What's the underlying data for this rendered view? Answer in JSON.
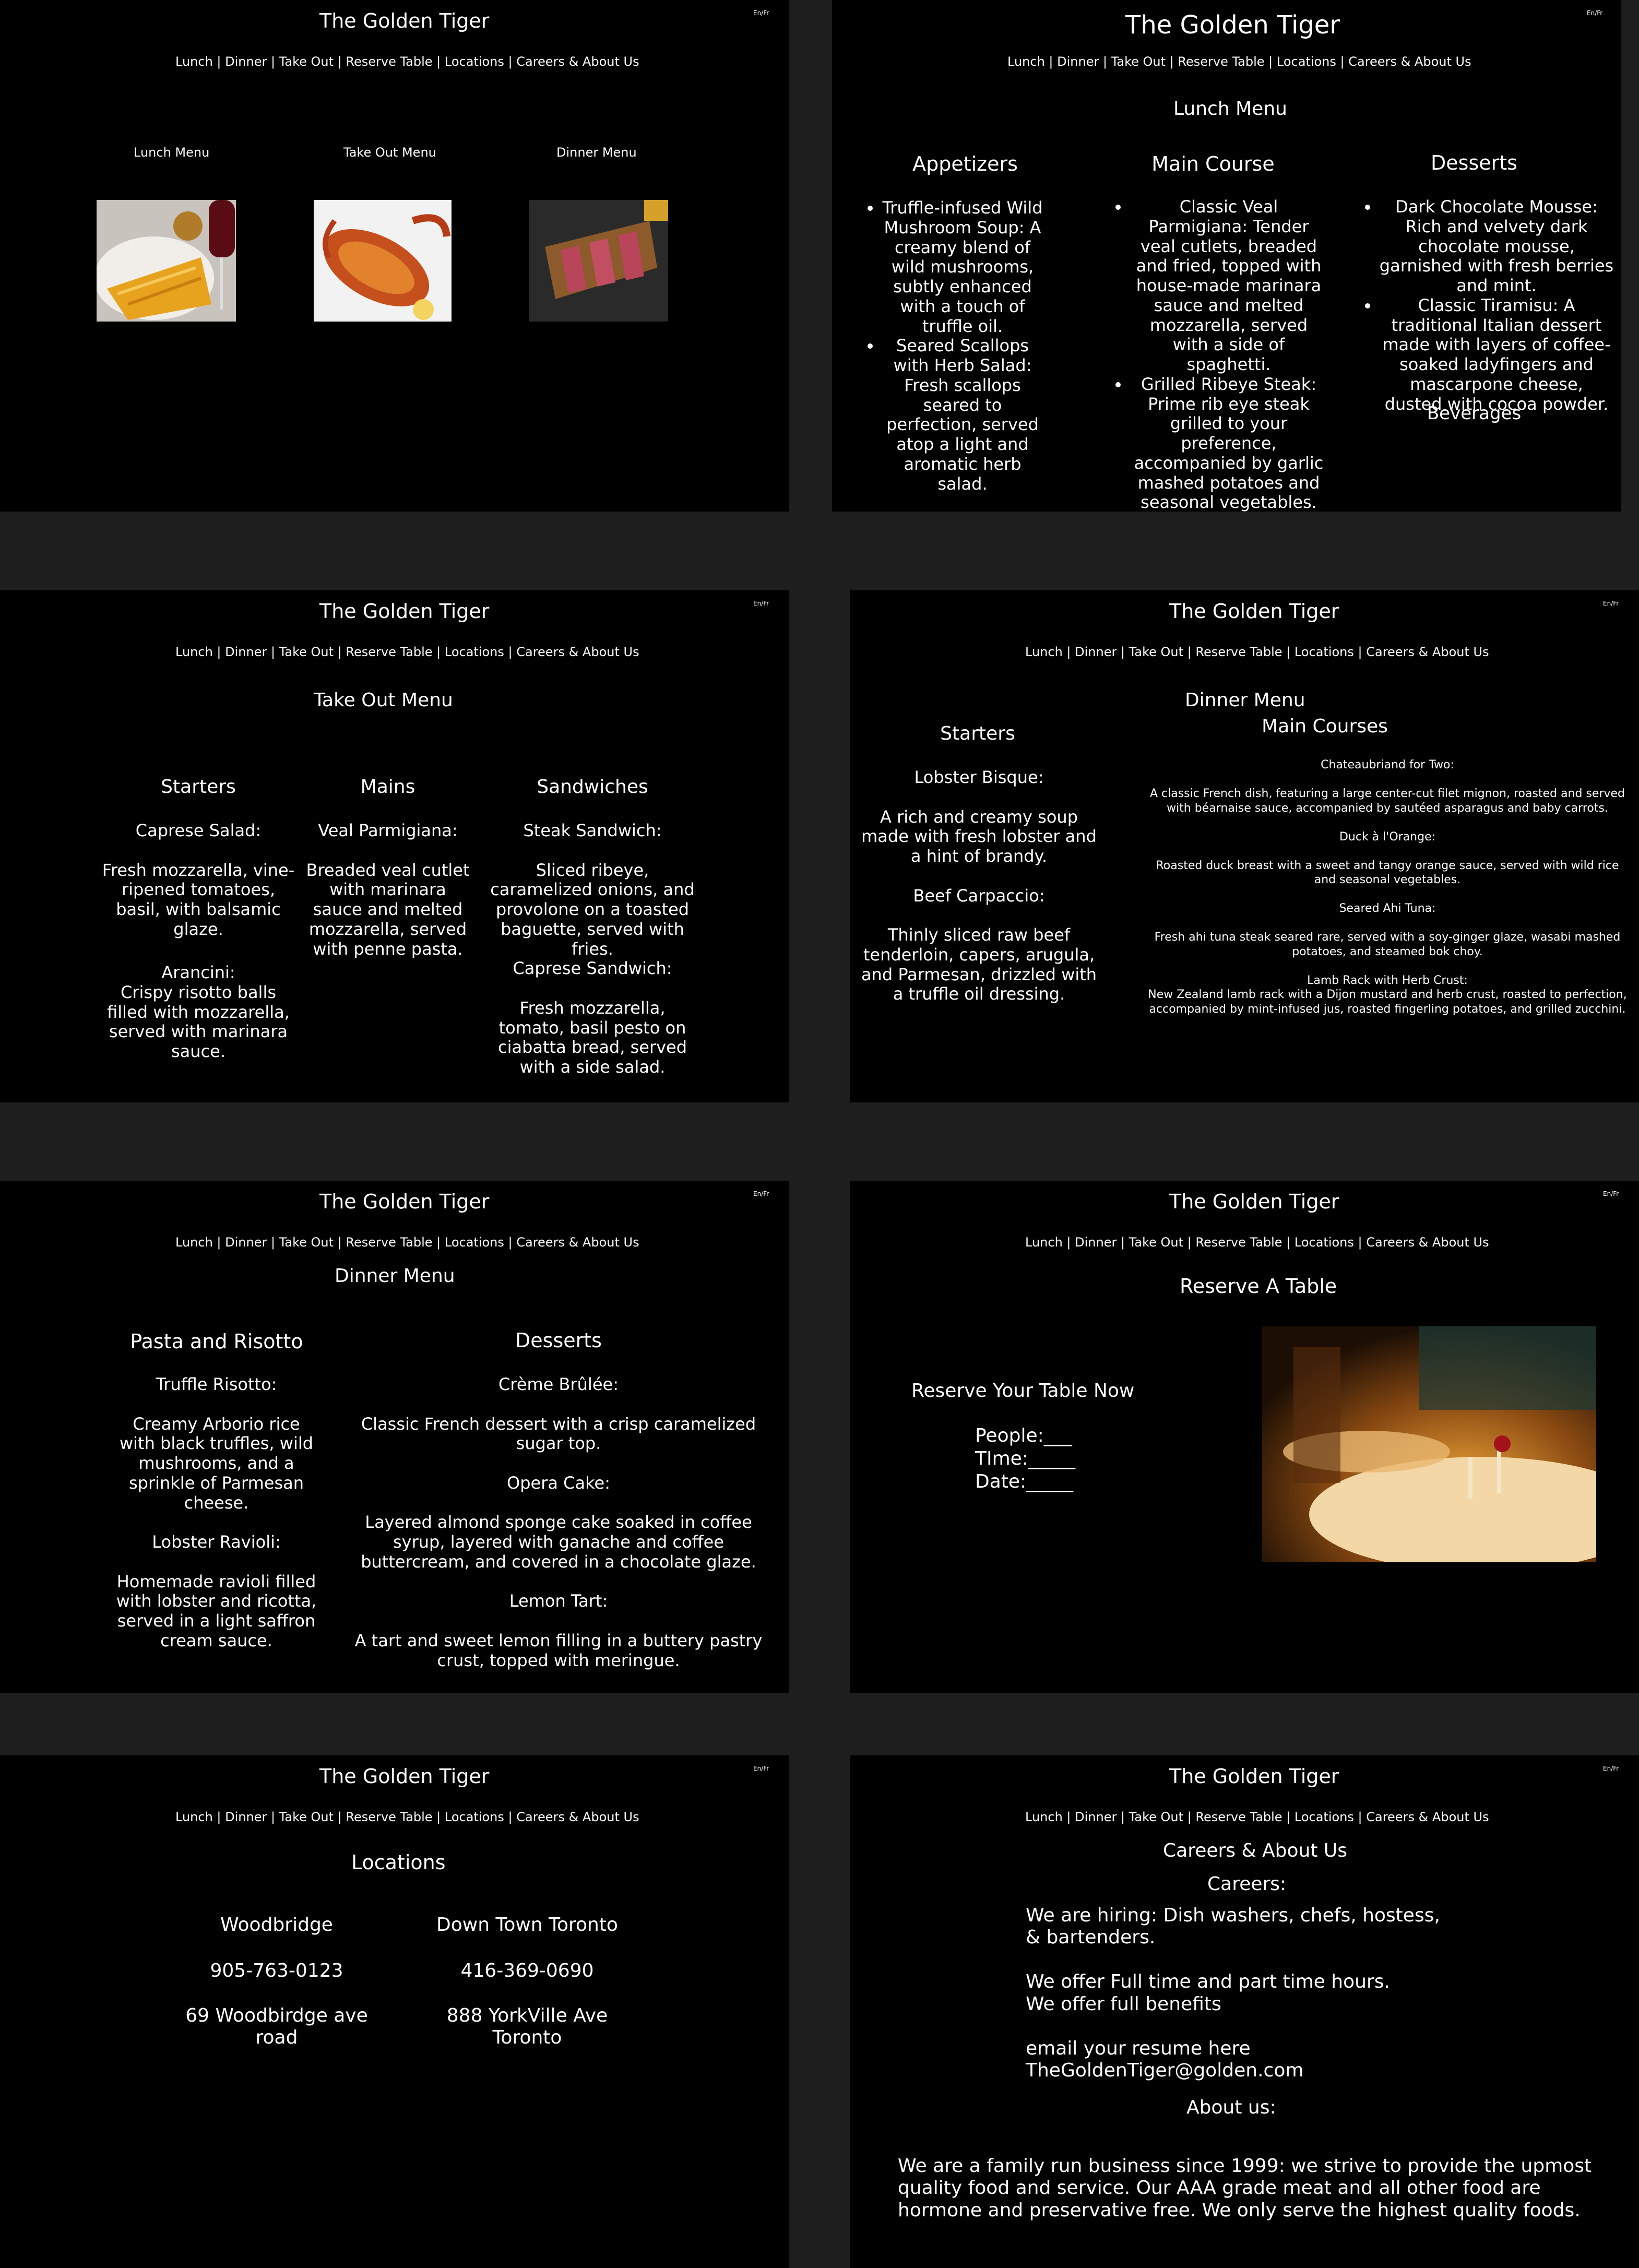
{
  "site_title": "The Golden Tiger",
  "lang_toggle": "En/Fr",
  "nav": [
    "Lunch",
    "Dinner",
    "Take Out",
    "Reserve Table",
    "Locations",
    "Careers & About Us"
  ],
  "nav_separator": "|",
  "home": {
    "cards": [
      {
        "label": "Lunch Menu",
        "image": "fries-and-wine-photo"
      },
      {
        "label": "Take Out Menu",
        "image": "lobster-photo"
      },
      {
        "label": "Dinner Menu",
        "image": "sliced-steak-photo"
      }
    ]
  },
  "lunch": {
    "heading": "Lunch Menu",
    "appetizers": {
      "title": "Appetizers",
      "items": [
        "Truffle-infused Wild Mushroom Soup: A creamy blend of wild mushrooms, subtly enhanced with a touch of truffle oil.",
        "Seared Scallops with Herb Salad: Fresh scallops seared to perfection, served atop a light and aromatic herb salad."
      ]
    },
    "main": {
      "title": "Main Course",
      "items": [
        "Classic Veal Parmigiana: Tender veal cutlets, breaded and fried, topped with house-made marinara sauce and melted mozzarella, served with a side of spaghetti.",
        "Grilled Ribeye Steak: Prime rib eye steak grilled to your preference, accompanied by garlic mashed potatoes and seasonal vegetables."
      ]
    },
    "desserts": {
      "title": "Desserts",
      "items": [
        "Dark Chocolate Mousse: Rich and velvety dark chocolate mousse, garnished with fresh berries and mint.",
        "Classic Tiramisu: A traditional Italian dessert made with layers of coffee-soaked ladyfingers and mascarpone cheese, dusted with cocoa powder."
      ],
      "extra": "Beverages"
    }
  },
  "takeout": {
    "heading": "Take Out Menu",
    "starters": {
      "title": "Starters",
      "text1": "Caprese Salad:\n\nFresh mozzarella, vine-ripened tomatoes, basil, with balsamic glaze.",
      "text2": "Arancini:\nCrispy risotto balls filled with mozzarella, served with marinara sauce."
    },
    "mains": {
      "title": "Mains",
      "text": "Veal Parmigiana:\n\nBreaded veal cutlet with marinara sauce and melted mozzarella, served with penne pasta."
    },
    "sandwiches": {
      "title": "Sandwiches",
      "text": "Steak Sandwich:\n\nSliced ribeye, caramelized onions, and provolone on a toasted baguette, served with fries.\nCaprese Sandwich:\n\nFresh mozzarella, tomato, basil pesto on ciabatta bread, served with a side salad."
    }
  },
  "dinner1": {
    "heading": "Dinner Menu",
    "starters": {
      "title": "Starters",
      "text": "Lobster Bisque:\n\nA rich and creamy soup made with fresh lobster and a hint of brandy.\n\nBeef Carpaccio:\n\nThinly sliced raw beef tenderloin, capers, arugula, and Parmesan, drizzled with a truffle oil dressing."
    },
    "main_courses": {
      "title": "Main Courses",
      "text": "Chateaubriand for Two:\n\nA classic French dish, featuring a large center-cut filet mignon, roasted and served with béarnaise sauce, accompanied by sautéed asparagus and baby carrots.\n\nDuck à l'Orange:\n\nRoasted duck breast with a sweet and tangy orange sauce, served with wild rice and seasonal vegetables.\n\nSeared Ahi Tuna:\n\nFresh ahi tuna steak seared rare, served with a soy-ginger glaze, wasabi mashed potatoes, and steamed bok choy.\n\nLamb Rack with Herb Crust:\nNew Zealand lamb rack with a Dijon mustard and herb crust, roasted to perfection, accompanied by mint-infused jus, roasted fingerling potatoes, and grilled zucchini."
    }
  },
  "dinner2": {
    "heading": "Dinner Menu",
    "pasta": {
      "title": "Pasta and Risotto",
      "text": "Truffle Risotto:\n\nCreamy Arborio rice with black truffles, wild mushrooms, and a sprinkle of Parmesan cheese.\n\nLobster Ravioli:\n\nHomemade ravioli filled with lobster and ricotta, served in a light saffron cream sauce."
    },
    "desserts": {
      "title": "Desserts",
      "text": "Crème Brûlée:\n\nClassic French dessert with a crisp caramelized sugar top.\n\nOpera Cake:\n\nLayered almond sponge cake soaked in coffee syrup, layered with ganache and coffee buttercream, and covered in a chocolate glaze.\n\nLemon Tart:\n\nA tart and sweet lemon filling in a buttery pastry crust, topped with meringue."
    }
  },
  "reserve": {
    "heading": "Reserve A Table",
    "subheading": "Reserve Your Table Now",
    "fields": [
      "People:___",
      "TIme:_____",
      "Date:_____"
    ],
    "image": "restaurant-interior-photo"
  },
  "locations": {
    "heading": "Locations",
    "items": [
      {
        "name": "Woodbridge",
        "phone": "905-763-0123",
        "address": "69 Woodbirdge ave road"
      },
      {
        "name": "Down Town Toronto",
        "phone": "416-369-0690",
        "address": "888 YorkVille Ave Toronto"
      }
    ]
  },
  "careers": {
    "heading": "Careers & About Us",
    "careers_title": "Careers:",
    "careers_text": "We are hiring: Dish washers, chefs, hostess, & bartenders.\n\nWe offer Full time and part time hours.\nWe offer full benefits\n\nemail your resume here\nTheGoldenTiger@golden.com",
    "about_title": "About us:",
    "about_text": "We are a family run business since 1999: we strive to provide the upmost quality food and service. Our AAA grade meat and all other food are hormone and preservative free. We only serve the highest quality foods."
  }
}
